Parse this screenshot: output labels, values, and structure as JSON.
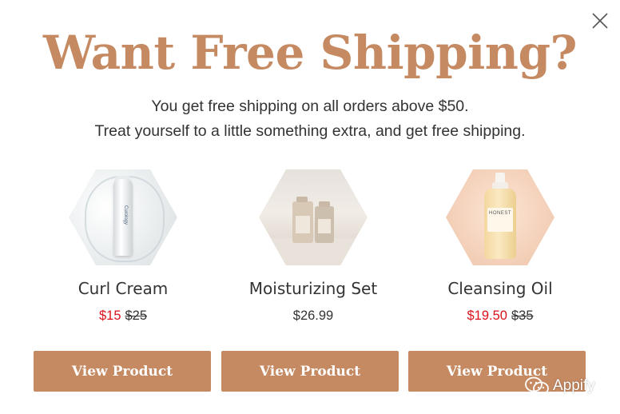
{
  "popup": {
    "title": "Want Free Shipping?",
    "subtitle_line1": "You get free shipping on all orders above $50.",
    "subtitle_line2": "Treat yourself to a little something extra, and get free shipping.",
    "close_icon": "close-icon",
    "accent_color": "#c68a62",
    "sale_color": "#d9121b"
  },
  "products": [
    {
      "name": "Curl Cream",
      "sale_price": "$15",
      "original_price": "$25",
      "button_label": "View Product",
      "bottle_text": "Curology"
    },
    {
      "name": "Moisturizing Set",
      "price": "$26.99",
      "button_label": "View Product"
    },
    {
      "name": "Cleansing Oil",
      "sale_price": "$19.50",
      "original_price": "$35",
      "button_label": "View Product",
      "bottle_text": "HONEST"
    }
  ],
  "watermark": {
    "text": "Appify",
    "icon": "wechat-icon"
  }
}
